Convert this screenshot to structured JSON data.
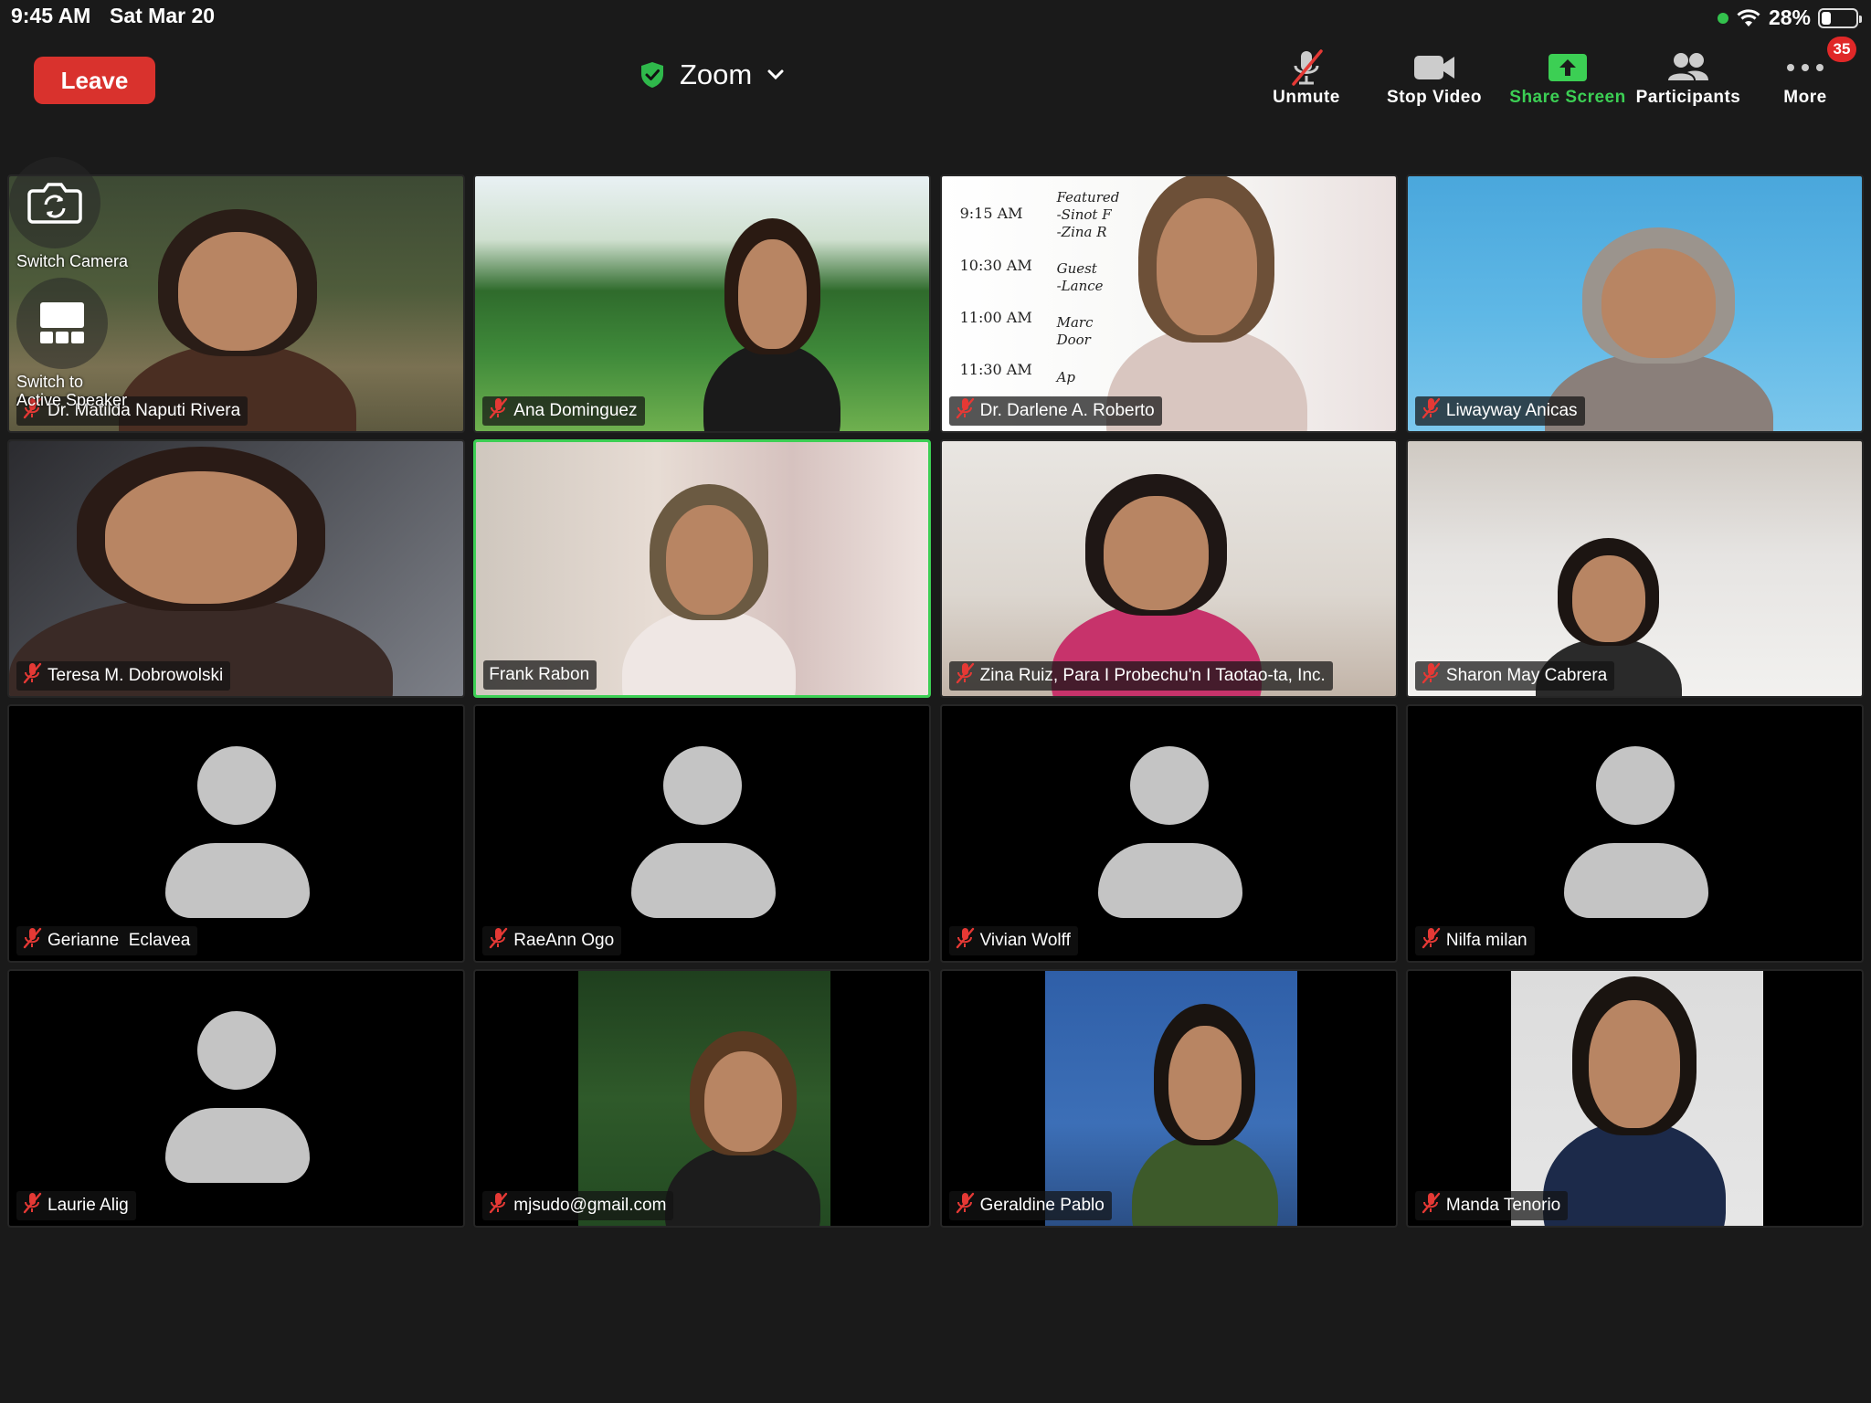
{
  "status_bar": {
    "time": "9:45 AM",
    "date": "Sat Mar 20",
    "battery_percent": "28%",
    "battery_level": 0.28
  },
  "top_bar": {
    "leave_label": "Leave",
    "meeting_title": "Zoom",
    "title_icon": "shield-check-icon"
  },
  "toolbar": {
    "unmute_label": "Unmute",
    "stop_video_label": "Stop Video",
    "share_screen_label": "Share Screen",
    "participants_label": "Participants",
    "more_label": "More",
    "more_badge": "35"
  },
  "camera_controls": {
    "switch_camera_label": "Switch Camera",
    "switch_active_speaker_label": "Switch to\nActive Speaker"
  },
  "colors": {
    "leave": "#d9322d",
    "share_screen": "#3ccf54",
    "muted_icon": "#e53935",
    "active_speaker_border": "#3ccf54",
    "badge": "#e02828"
  },
  "schedule": {
    "rows": [
      "9:15 AM",
      "10:30 AM",
      "11:00 AM",
      "11:30 AM"
    ],
    "snippets": [
      "Featured",
      "-Sinot F",
      "-Zina R",
      "Guest",
      "-Lance",
      "Marc",
      "Door",
      "Ap"
    ]
  },
  "participants": [
    {
      "name": "Dr. Matilda Naputi Rivera",
      "muted": true,
      "video": true
    },
    {
      "name": "Ana Dominguez",
      "muted": true,
      "video": true
    },
    {
      "name": "Dr. Darlene A. Roberto",
      "muted": true,
      "video": true
    },
    {
      "name": "Liwayway Anicas",
      "muted": true,
      "video": true
    },
    {
      "name": "Teresa M. Dobrowolski",
      "muted": true,
      "video": true
    },
    {
      "name": "Frank Rabon",
      "muted": false,
      "video": true,
      "active_speaker": true
    },
    {
      "name": "Zina Ruiz, Para I Probechu'n I Taotao-ta, Inc.",
      "muted": true,
      "video": true
    },
    {
      "name": "Sharon May Cabrera",
      "muted": true,
      "video": true
    },
    {
      "name": "Gerianne  Eclavea",
      "muted": true,
      "video": false
    },
    {
      "name": "RaeAnn Ogo",
      "muted": true,
      "video": false
    },
    {
      "name": "Vivian Wolff",
      "muted": true,
      "video": false
    },
    {
      "name": "Nilfa milan",
      "muted": true,
      "video": false
    },
    {
      "name": "Laurie Alig",
      "muted": true,
      "video": false
    },
    {
      "name": "mjsudo@gmail.com",
      "muted": true,
      "video": true
    },
    {
      "name": "Geraldine Pablo",
      "muted": true,
      "video": true
    },
    {
      "name": "Manda Tenorio",
      "muted": true,
      "video": true
    }
  ]
}
